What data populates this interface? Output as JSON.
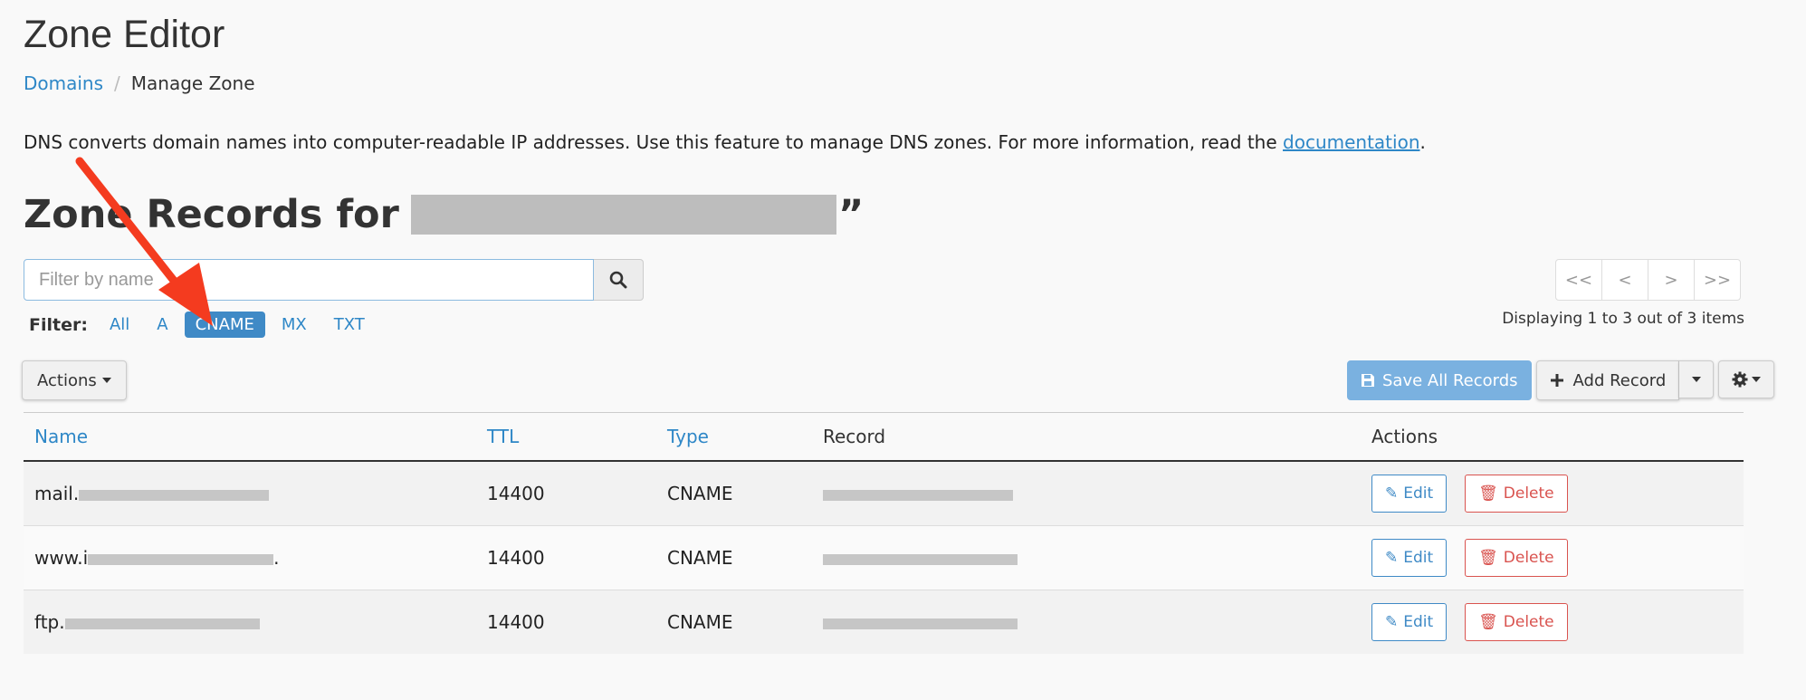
{
  "header": {
    "title": "Zone Editor",
    "breadcrumb": {
      "parent": "Domains",
      "separator": "/",
      "current": "Manage Zone"
    }
  },
  "intro": {
    "text": "DNS converts domain names into computer-readable IP addresses. Use this feature to manage DNS zones. For more information, read the ",
    "link": "documentation",
    "suffix": "."
  },
  "zone": {
    "heading_prefix": "Zone Records for “",
    "heading_suffix": "”"
  },
  "search": {
    "placeholder": "Filter by name"
  },
  "filter": {
    "label": "Filter:",
    "options": [
      "All",
      "A",
      "CNAME",
      "MX",
      "TXT"
    ],
    "active": "CNAME"
  },
  "pager": {
    "first": "<<",
    "prev": "<",
    "next": ">",
    "last": ">>",
    "info": "Displaying 1 to 3 out of 3 items"
  },
  "toolbar": {
    "actions_label": "Actions",
    "save_all_label": "Save All Records",
    "add_record_label": "Add Record"
  },
  "table": {
    "columns": {
      "name": "Name",
      "ttl": "TTL",
      "type": "Type",
      "record": "Record",
      "actions": "Actions"
    },
    "rows": [
      {
        "name_prefix": "mail.",
        "name_suffix": "",
        "ttl": "14400",
        "type": "CNAME"
      },
      {
        "name_prefix": "www.i",
        "name_suffix": ".",
        "ttl": "14400",
        "type": "CNAME"
      },
      {
        "name_prefix": "ftp.",
        "name_suffix": "",
        "ttl": "14400",
        "type": "CNAME"
      }
    ],
    "edit_label": "Edit",
    "delete_label": "Delete"
  },
  "colors": {
    "link": "#2e87c7",
    "active_filter": "#3f8ac6",
    "save_button": "#7ab1e0",
    "delete": "#d9534f",
    "annotation_arrow": "#f43b1f"
  },
  "icons": {
    "search": "search-icon",
    "save": "floppy-disk-icon",
    "add": "plus-icon",
    "settings": "gear-icon",
    "edit": "pencil-icon",
    "delete": "trash-icon"
  }
}
